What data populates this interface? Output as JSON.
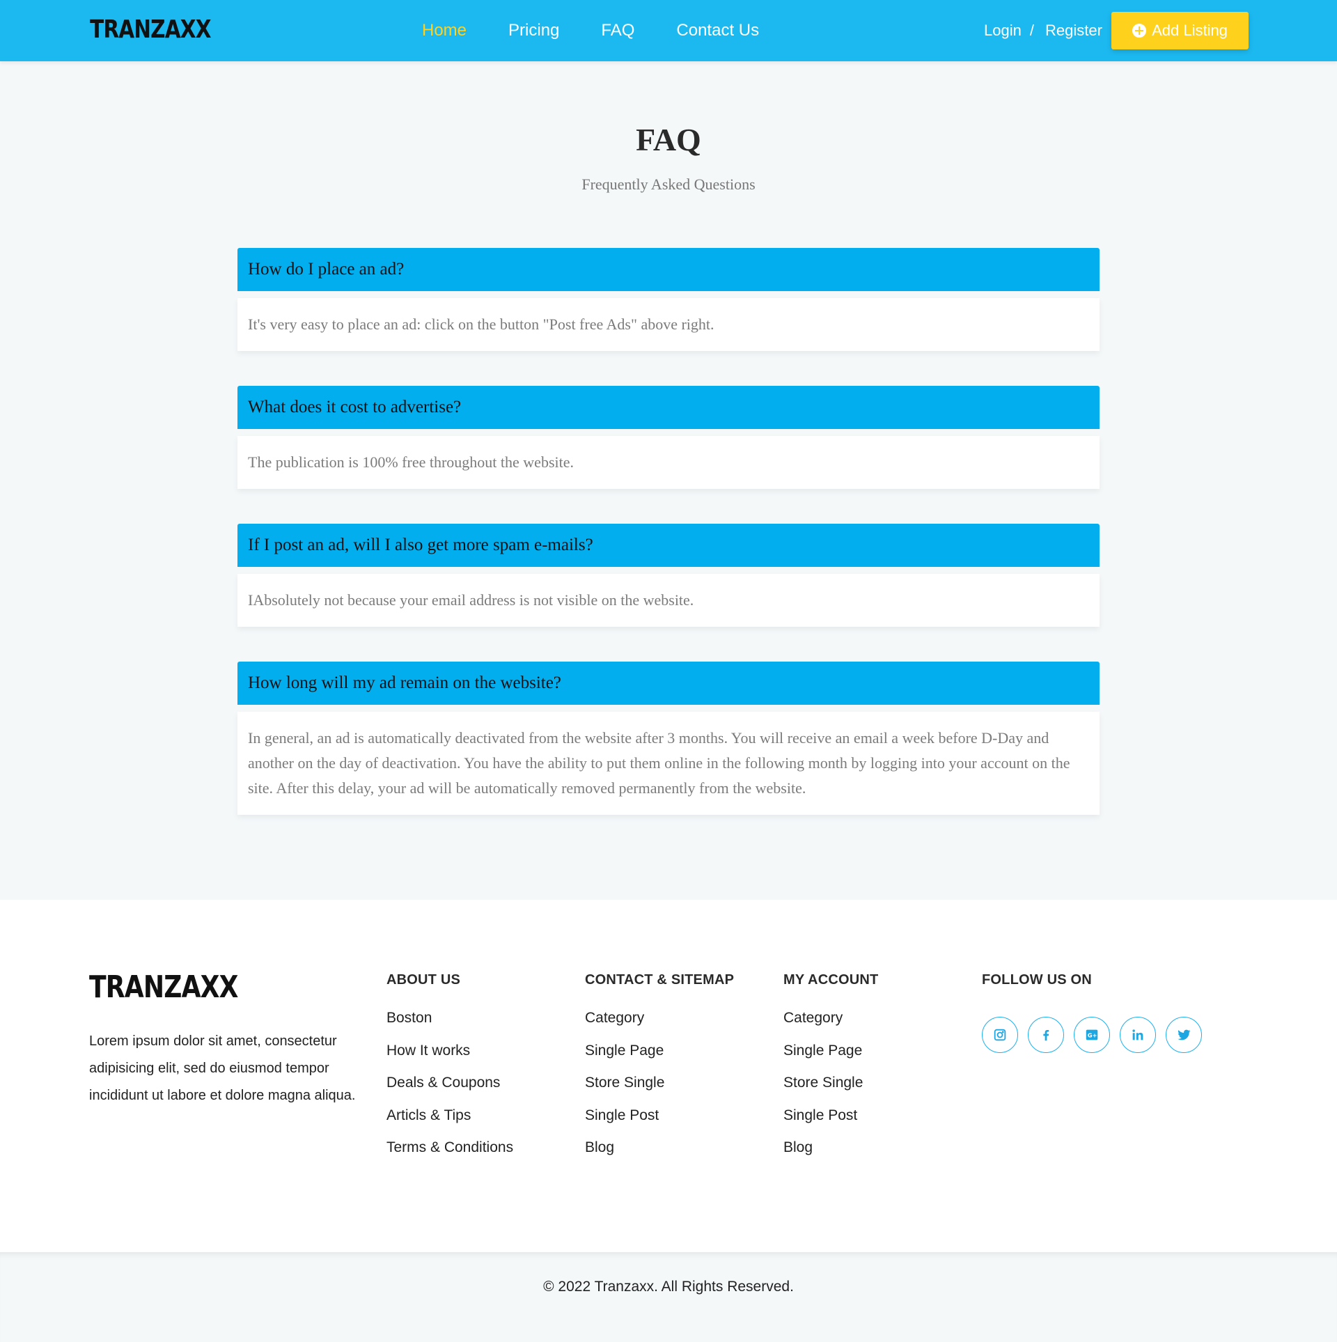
{
  "header": {
    "logo": "TRANZAXX",
    "nav": [
      {
        "label": "Home",
        "active": true
      },
      {
        "label": "Pricing",
        "active": false
      },
      {
        "label": "FAQ",
        "active": false
      },
      {
        "label": "Contact Us",
        "active": false
      }
    ],
    "login": "Login",
    "separator": "/",
    "register": "Register",
    "add_listing": "Add Listing",
    "colors": {
      "bar": "#1cb9f0",
      "active_link": "#ffd21f",
      "button": "#fed21c"
    }
  },
  "page": {
    "title": "FAQ",
    "subtitle": "Frequently Asked Questions"
  },
  "faq": [
    {
      "q": "How do I place an ad?",
      "a": "It's very easy to place an ad: click on the button \"Post free Ads\" above right."
    },
    {
      "q": "What does it cost to advertise?",
      "a": "The publication is 100% free throughout the website."
    },
    {
      "q": "If I post an ad, will I also get more spam e-mails?",
      "a": "IAbsolutely not because your email address is not visible on the website."
    },
    {
      "q": "How long will my ad remain on the website?",
      "a": "In general, an ad is automatically deactivated from the website after 3 months. You will receive an email a week before D-Day and another on the day of deactivation. You have the ability to put them online in the following month by logging into your account on the site. After this delay, your ad will be automatically removed permanently from the website."
    }
  ],
  "footer": {
    "logo": "TRANZAXX",
    "about_text": "Lorem ipsum dolor sit amet, consectetur adipisicing elit, sed do eiusmod tempor incididunt ut labore et dolore magna aliqua.",
    "columns": [
      {
        "title": "ABOUT US",
        "items": [
          "Boston",
          "How It works",
          "Deals & Coupons",
          "Articls & Tips",
          "Terms & Conditions"
        ]
      },
      {
        "title": "CONTACT & SITEMAP",
        "items": [
          "Category",
          "Single Page",
          "Store Single",
          "Single Post",
          "Blog"
        ]
      },
      {
        "title": "MY ACCOUNT",
        "items": [
          "Category",
          "Single Page",
          "Store Single",
          "Single Post",
          "Blog"
        ]
      }
    ],
    "follow_title": "FOLLOW US ON",
    "social_icons": [
      "instagram-icon",
      "facebook-icon",
      "google-plus-icon",
      "linkedin-icon",
      "twitter-icon"
    ],
    "copyright": "© 2022 Tranzaxx. All Rights Reserved."
  }
}
